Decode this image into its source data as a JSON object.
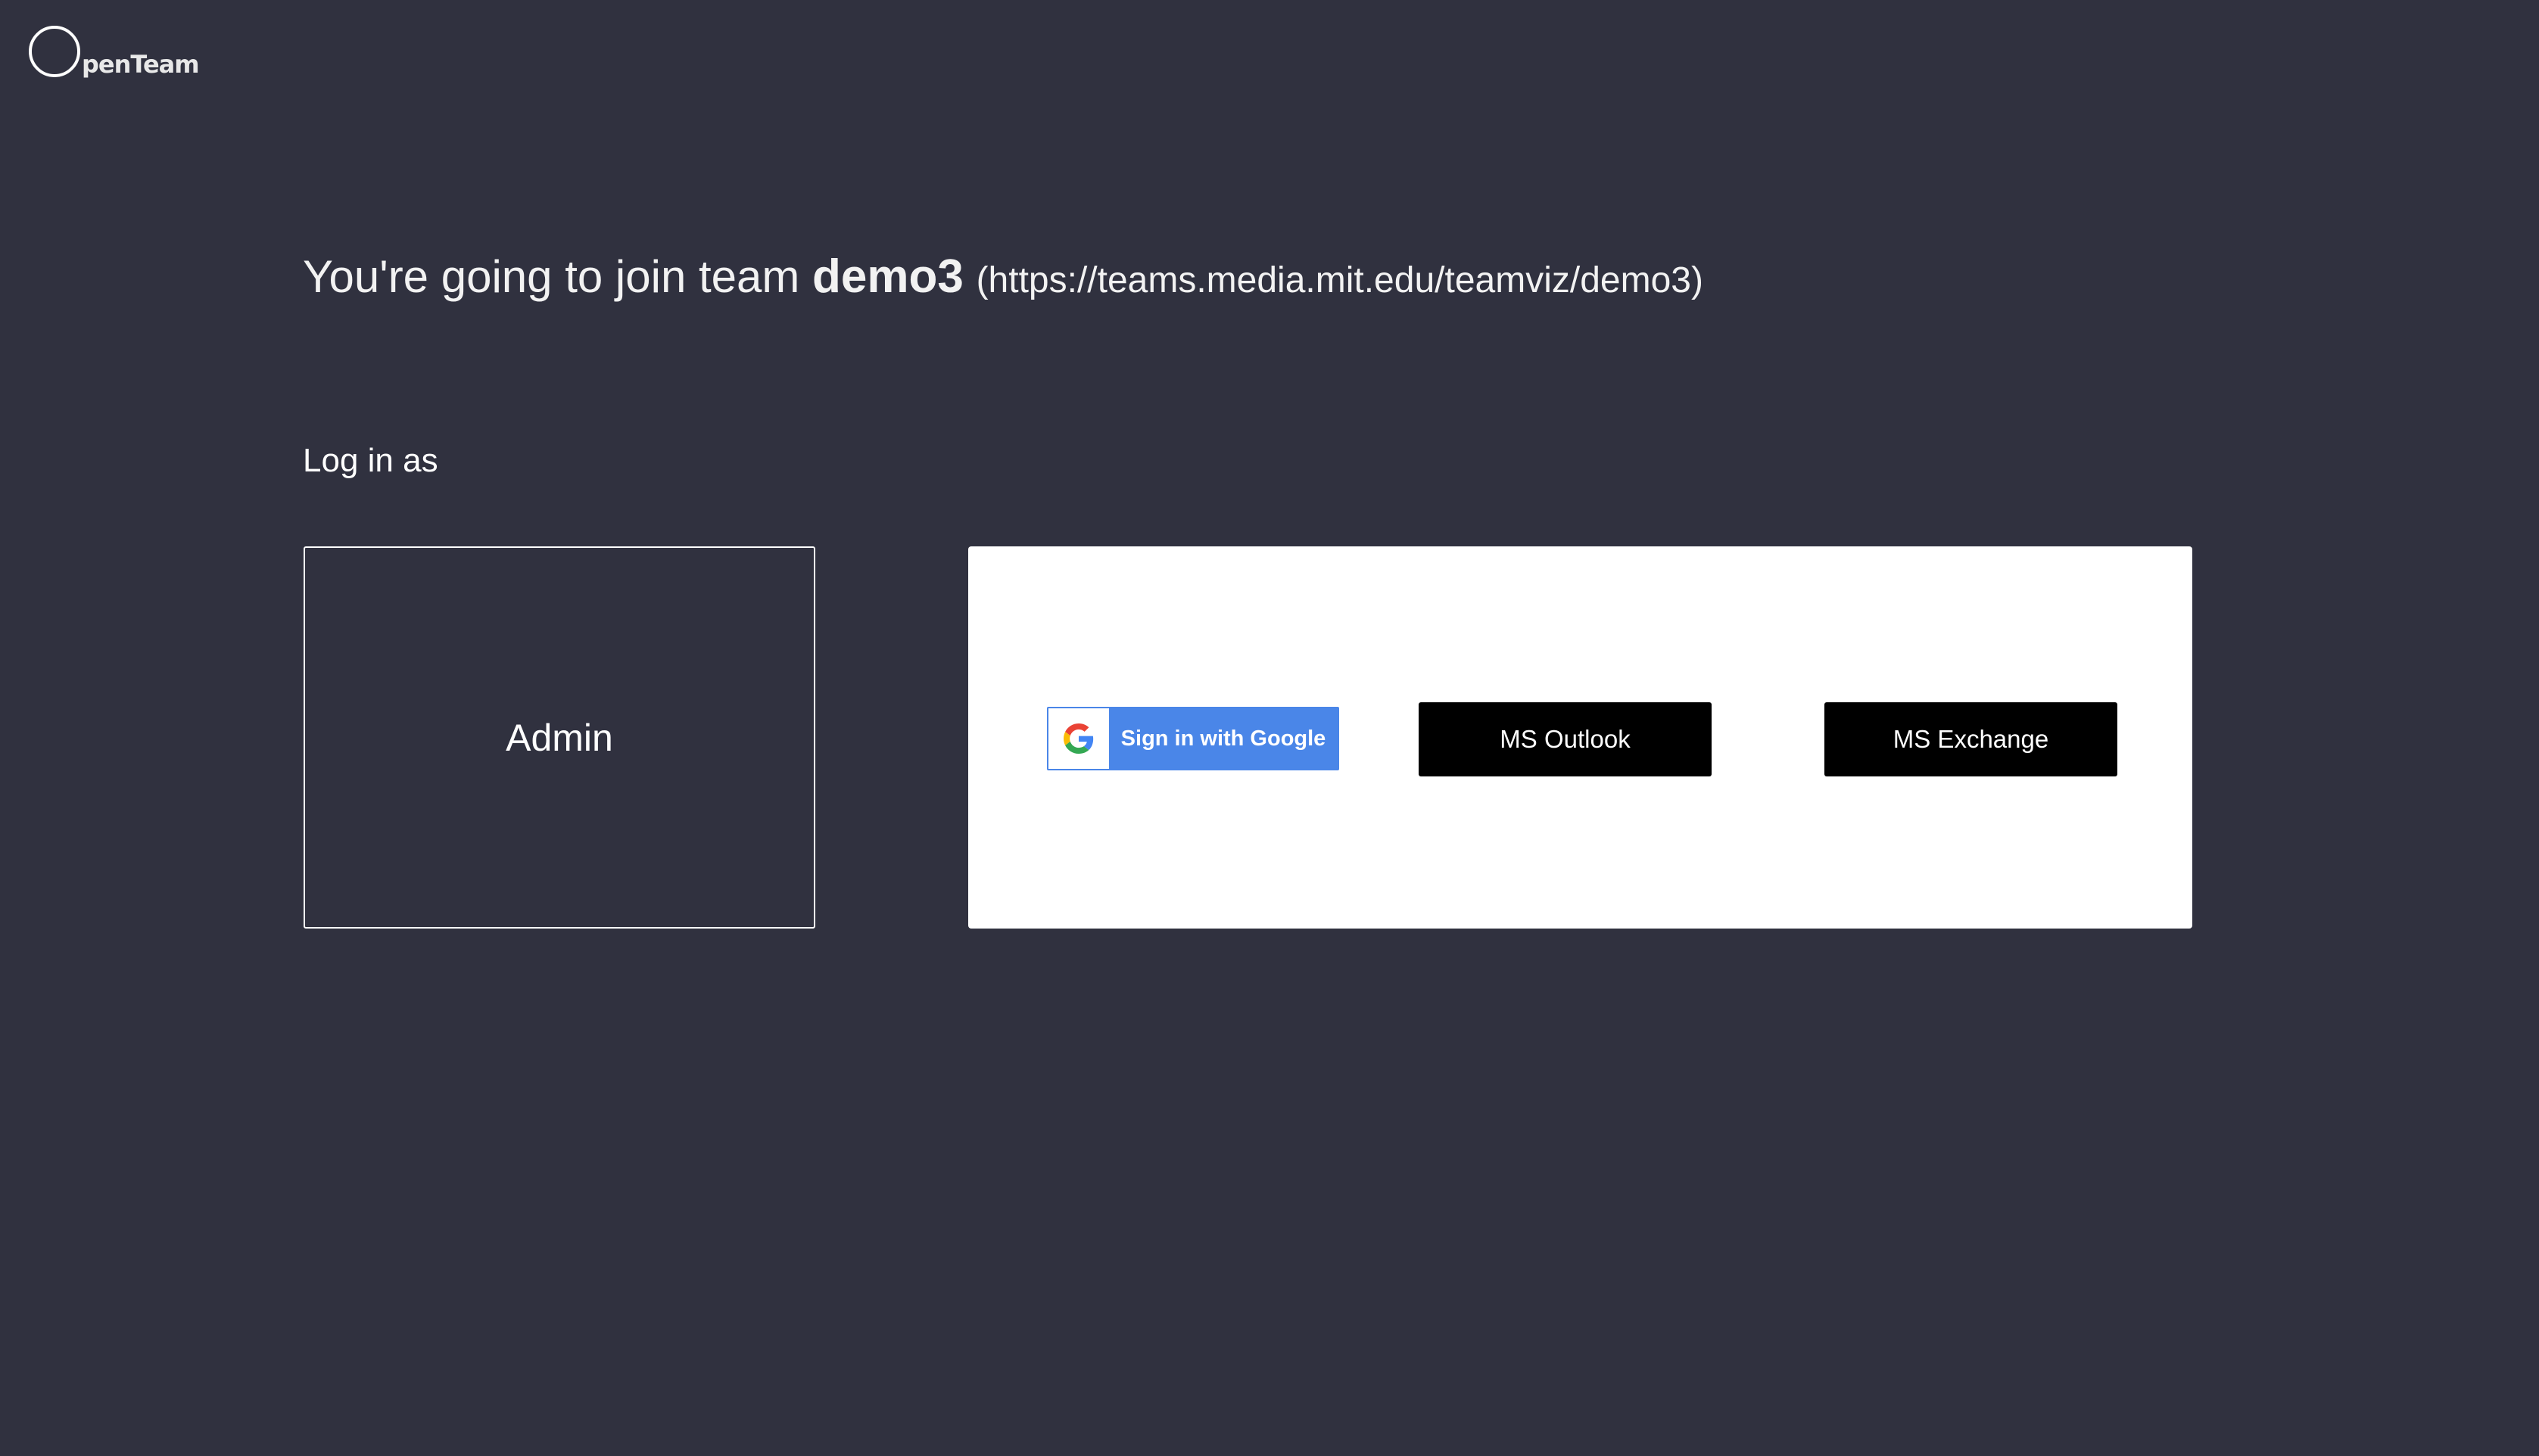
{
  "logo": {
    "text": "penTeam"
  },
  "header": {
    "prefix": "You're going to join team ",
    "team_name": "demo3",
    "team_url": "(https://teams.media.mit.edu/teamviz/demo3)"
  },
  "login": {
    "label": "Log in as",
    "admin_label": "Admin",
    "google_label": "Sign in with Google",
    "outlook_label": "MS Outlook",
    "exchange_label": "MS Exchange"
  },
  "colors": {
    "background": "#30313f",
    "google_blue": "#4a86e8",
    "button_dark": "#000000",
    "panel": "#ffffff"
  },
  "icons": {
    "logo": "open-team-logo-circle",
    "google": "google-g-icon"
  }
}
